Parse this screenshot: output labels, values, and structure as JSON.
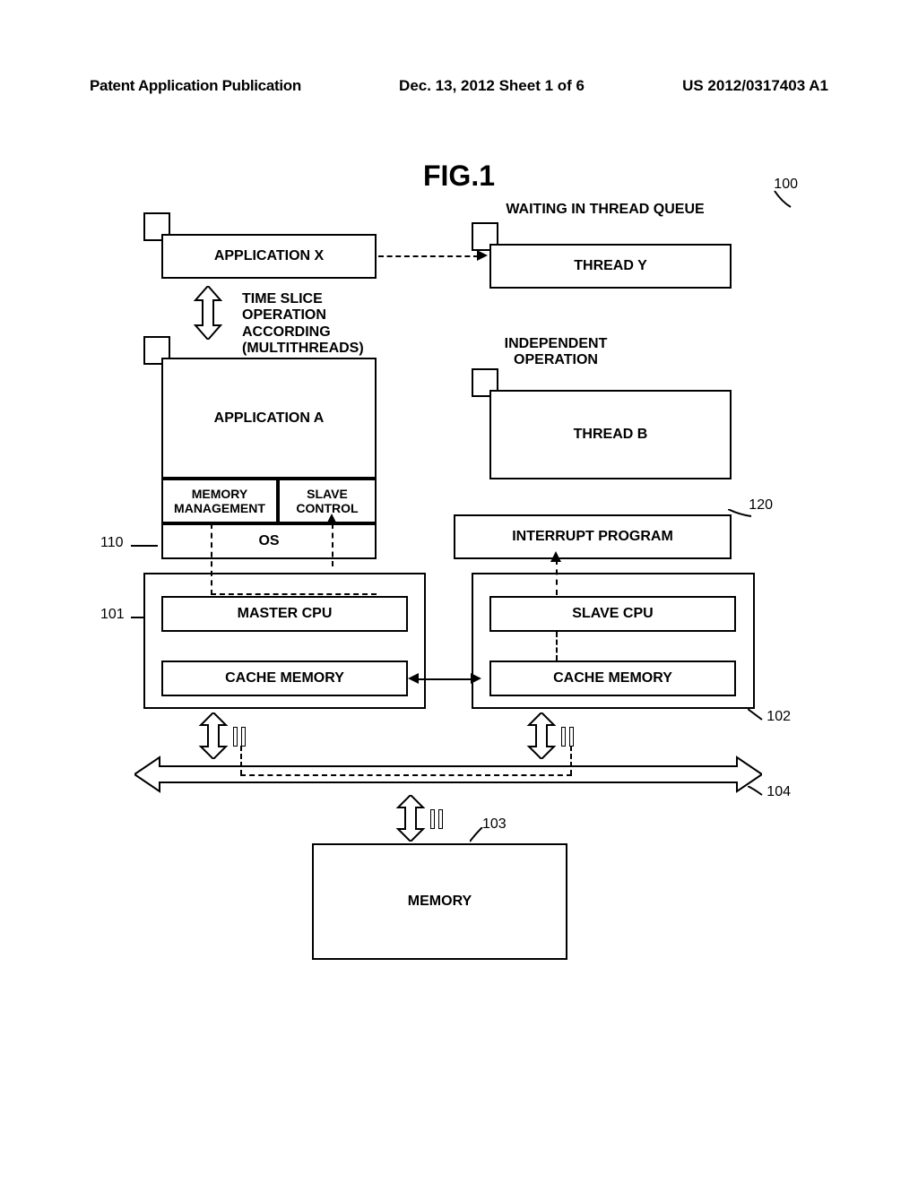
{
  "header": {
    "left": "Patent Application Publication",
    "middle": "Dec. 13, 2012  Sheet 1 of 6",
    "right": "US 2012/0317403 A1"
  },
  "figure_title": "FIG.1",
  "refs": {
    "r100": "100",
    "r110": "110",
    "r101": "101",
    "r120": "120",
    "r102": "102",
    "r103": "103",
    "r104": "104"
  },
  "boxes": {
    "app_x": "APPLICATION X",
    "thread_y": "THREAD Y",
    "app_a": "APPLICATION A",
    "thread_b": "THREAD B",
    "mem_mgmt": "MEMORY\nMANAGEMENT",
    "slave_ctrl": "SLAVE\nCONTROL",
    "os": "OS",
    "interrupt": "INTERRUPT PROGRAM",
    "master_cpu": "MASTER CPU",
    "slave_cpu": "SLAVE CPU",
    "cache1": "CACHE MEMORY",
    "cache2": "CACHE MEMORY",
    "memory": "MEMORY"
  },
  "labels": {
    "waiting": "WAITING IN THREAD\nQUEUE",
    "timeslice": "TIME SLICE\nOPERATION\nACCORDING\n(MULTITHREADS)",
    "independent": "INDEPENDENT\nOPERATION"
  }
}
